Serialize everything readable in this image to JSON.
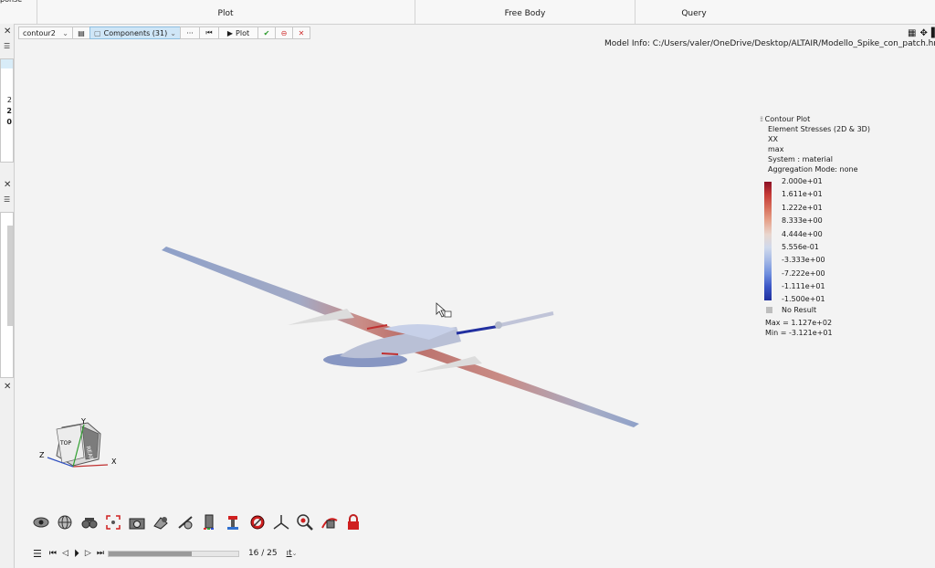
{
  "topbar": {
    "response_label": "ponse",
    "tabs": [
      "Plot",
      "Free Body",
      "Query"
    ]
  },
  "toolbar": {
    "result_select": "contour2",
    "components_label": "Components (31)",
    "more_label": "···",
    "plot_label": "Plot"
  },
  "left_panel": {
    "digits": [
      "2",
      "2",
      "0"
    ]
  },
  "model_info": "Model Info: C:/Users/valer/OneDrive/Desktop/ALTAIR/Modello_Spike_con_patch.hm",
  "legend": {
    "title": "Contour Plot",
    "lines": [
      "Element Stresses (2D & 3D)",
      "XX",
      "max",
      "System : material",
      "Aggregation Mode: none"
    ],
    "values": [
      "2.000e+01",
      "1.611e+01",
      "1.222e+01",
      "8.333e+00",
      "4.444e+00",
      "5.556e-01",
      "-3.333e+00",
      "-7.222e+00",
      "-1.111e+01",
      "-1.500e+01"
    ],
    "colors": [
      "#8c1025",
      "#c53a36",
      "#d8705c",
      "#e6a48d",
      "#e9d7cf",
      "#cfd9ec",
      "#a5b9e6",
      "#6f8ede",
      "#3b56c6",
      "#1f2f9e"
    ],
    "no_result": "No Result",
    "max": "Max =  1.127e+02",
    "min": "Min = -3.121e+01"
  },
  "triad": {
    "x": "X",
    "y": "Y",
    "z": "Z",
    "top": "TOP",
    "rear": "REAR"
  },
  "bottom_icons": [
    "visualization-icon",
    "globe-icon",
    "binoculars-icon",
    "fit-view-icon",
    "camera-icon",
    "section-icon",
    "measure-icon",
    "color-legend-icon",
    "contour-icon",
    "deformed-icon",
    "vector-icon",
    "zoom-icon",
    "tracing-icon",
    "lock-icon"
  ],
  "animation": {
    "frame_label": "16 / 25",
    "progress": 0.64
  }
}
